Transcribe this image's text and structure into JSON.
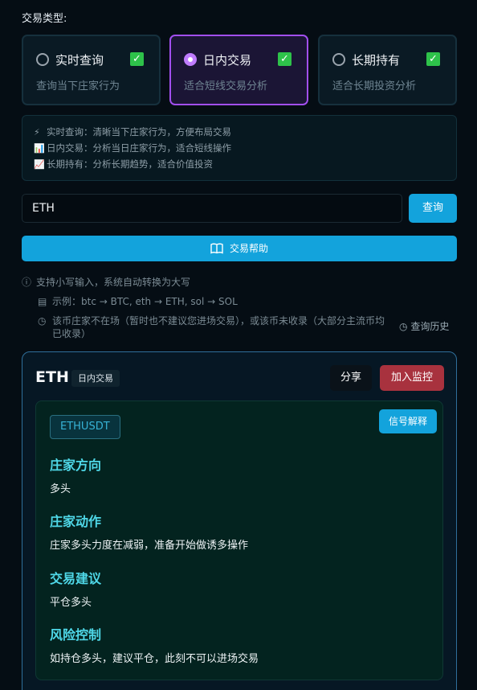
{
  "trade_type_label": "交易类型:",
  "trade_types": [
    {
      "name": "实时查询",
      "desc": "查询当下庄家行为",
      "selected": false
    },
    {
      "name": "日内交易",
      "desc": "适合短线交易分析",
      "selected": true
    },
    {
      "name": "长期持有",
      "desc": "适合长期投资分析",
      "selected": false
    }
  ],
  "info_lines": [
    {
      "icon": "⚡",
      "text": "实时查询：清晰当下庄家行为，方便布局交易"
    },
    {
      "icon": "📊",
      "text": "日内交易：分析当日庄家行为，适合短线操作"
    },
    {
      "icon": "📈",
      "text": "长期持有：分析长期趋势，适合价值投资"
    }
  ],
  "search": {
    "value": "ETH",
    "button": "查询"
  },
  "help_button": "交易帮助",
  "tips": [
    "支持小写输入，系统自动转换为大写",
    "示例：btc → BTC, eth → ETH, sol → SOL",
    "该币庄家不在场（暂时也不建议您进场交易），或该币未收录（大部分主流币均",
    "已收录）"
  ],
  "history_link": "查询历史",
  "result": {
    "coin": "ETH",
    "tag": "日内交易",
    "share": "分享",
    "monitor": "加入监控",
    "symbol": "ETHUSDT",
    "signal_button": "信号解释",
    "sections": [
      {
        "heading": "庄家方向",
        "text": "多头"
      },
      {
        "heading": "庄家动作",
        "text": "庄家多头力度在减弱，准备开始做诱多操作"
      },
      {
        "heading": "交易建议",
        "text": "平仓多头"
      },
      {
        "heading": "风险控制",
        "text": "如持仓多头，建议平仓，此刻不可以进场交易"
      }
    ]
  },
  "colors": {
    "accent": "#13a3dc",
    "selected_border": "#a24ff0",
    "monitor": "#a8323e",
    "heading": "#4fd8e8"
  }
}
